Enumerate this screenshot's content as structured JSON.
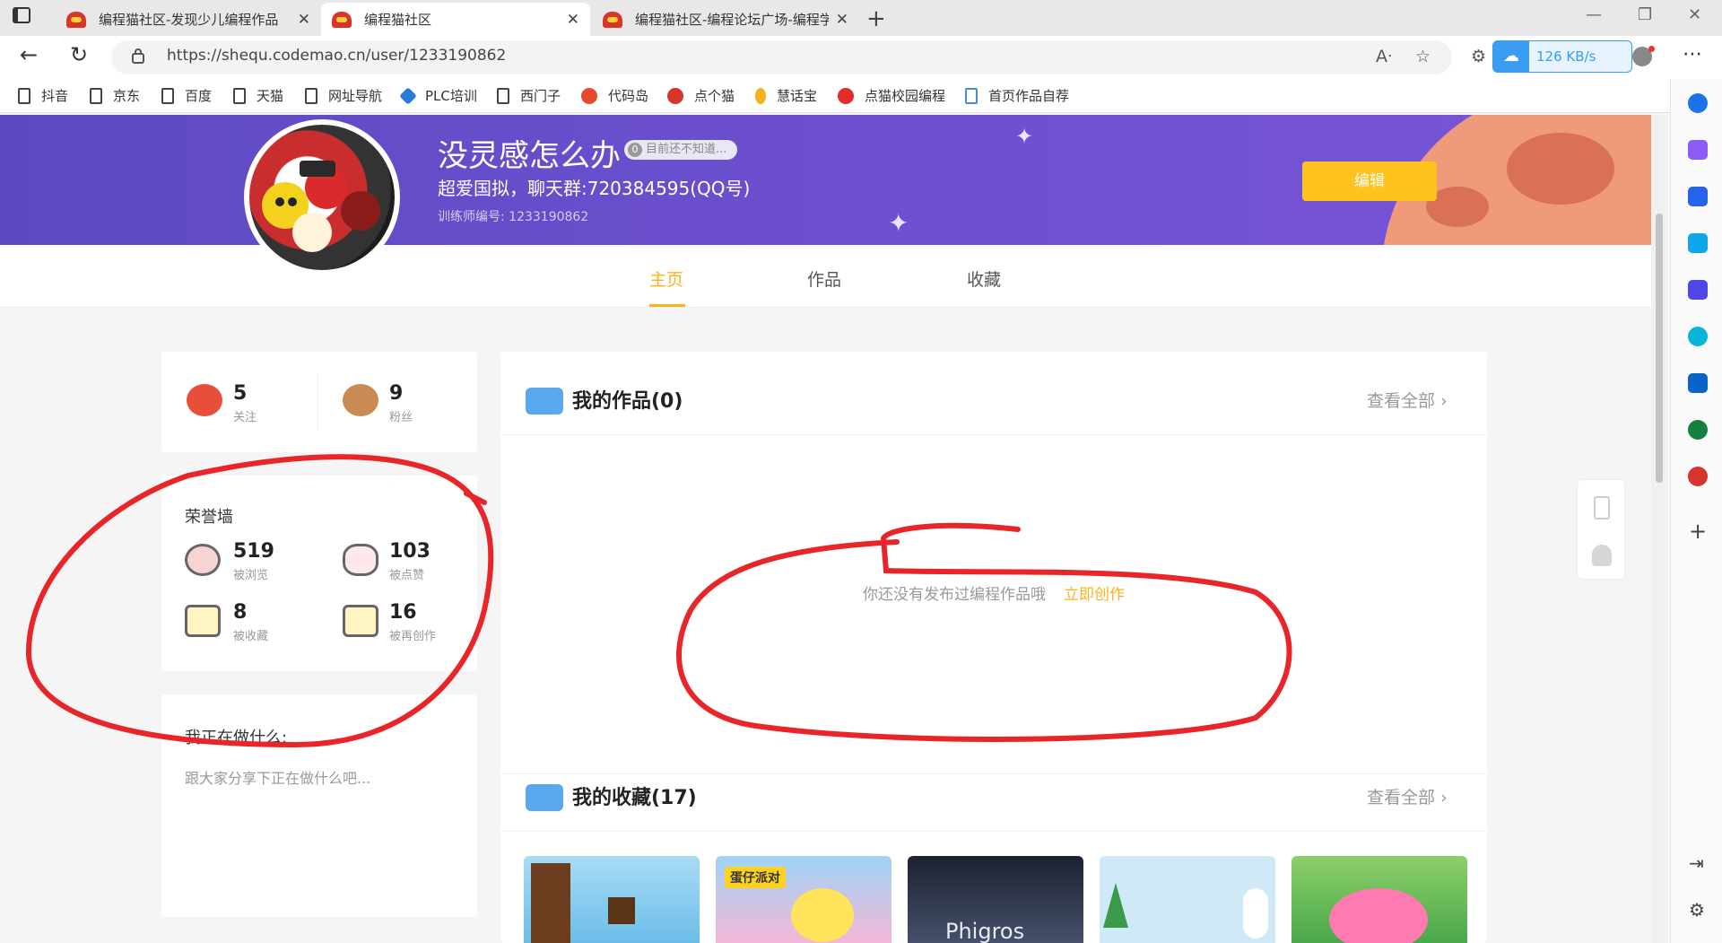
{
  "browser": {
    "tabs": [
      {
        "title": "编程猫社区-发现少儿编程作品"
      },
      {
        "title": "编程猫社区"
      },
      {
        "title": "编程猫社区-编程论坛广场-编程学"
      }
    ],
    "url": "https://shequ.codemao.cn/user/1233190862",
    "download_speed": "126 KB/s",
    "bookmarks": [
      "抖音",
      "京东",
      "百度",
      "天猫",
      "网址导航",
      "PLC培训",
      "西门子",
      "代码岛",
      "点个猫",
      "慧话宝",
      "点猫校园编程",
      "首页作品自荐"
    ],
    "colors": {
      "accent": "#3a9cf2"
    }
  },
  "profile": {
    "name": "没灵感怎么办",
    "status_tag": "目前还不知道...",
    "status_tag_badge": "0",
    "bio": "超爱国拟，聊天群:720384595(QQ号)",
    "trainer_id": "训练师编号: 1233190862",
    "edit_label": "编辑"
  },
  "page_tabs": [
    "主页",
    "作品",
    "收藏"
  ],
  "follow_stats": {
    "following": {
      "value": "5",
      "label": "关注"
    },
    "fans": {
      "value": "9",
      "label": "粉丝"
    }
  },
  "honor_wall": {
    "title": "荣誉墙",
    "items": [
      {
        "value": "519",
        "label": "被浏览",
        "icon": "eye-icon"
      },
      {
        "value": "103",
        "label": "被点赞",
        "icon": "like-icon"
      },
      {
        "value": "8",
        "label": "被收藏",
        "icon": "collect-icon"
      },
      {
        "value": "16",
        "label": "被再创作",
        "icon": "remix-icon"
      }
    ]
  },
  "doing": {
    "title": "我正在做什么:",
    "placeholder": "跟大家分享下正在做什么吧..."
  },
  "works": {
    "title": "我的作品(0)",
    "see_all": "查看全部",
    "empty_text": "你还没有发布过编程作品哦",
    "create_link": "立即创作"
  },
  "favorites": {
    "title": "我的收藏(17)",
    "see_all": "查看全部",
    "thumb_text": "Phigros",
    "thumb_badge": "蛋仔派对"
  },
  "colors": {
    "brand_orange": "#ffb31a",
    "edit_button": "#ffc31f",
    "banner": "#6a4fcf",
    "annotation": "#e8262a"
  }
}
